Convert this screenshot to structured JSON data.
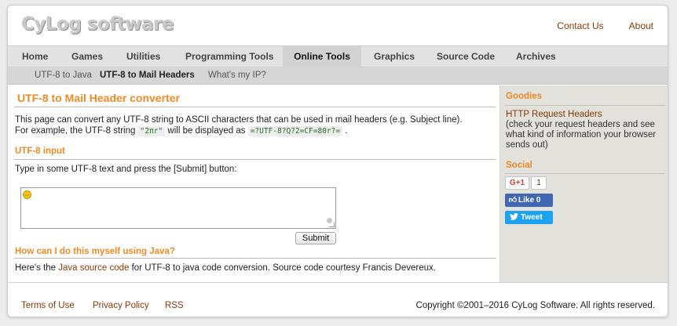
{
  "header": {
    "logo": "CyLog software",
    "links": [
      "Contact Us",
      "About"
    ]
  },
  "main_nav": {
    "items": [
      "Home",
      "Games",
      "Utilities",
      "Programming Tools",
      "Online Tools",
      "Graphics",
      "Source Code",
      "Archives"
    ],
    "active": "Online Tools"
  },
  "sub_nav": {
    "items": [
      "UTF-8 to Java",
      "UTF-8 to Mail Headers",
      "What's my IP?"
    ],
    "active": "UTF-8 to Mail Headers"
  },
  "content": {
    "title": "UTF-8 to Mail Header converter",
    "intro_line1": "This page can convert any UTF-8 string to ASCII characters that can be used in mail headers (e.g. Subject line).",
    "intro_line2_a": "For example, the UTF-8 string",
    "example_input": "\"2πr\"",
    "intro_line2_b": "will be displayed as",
    "example_output": "=?UTF-8?Q?2=CF=80r?=",
    "intro_line2_c": ".",
    "section_input_title": "UTF-8 input",
    "input_instruction": "Type in some UTF-8 text and press the [Submit] button:",
    "textarea_value": "",
    "submit_label": "Submit",
    "section_java_title": "How can I do this myself using Java?",
    "java_text_a": "Here's the",
    "java_link": "Java source code",
    "java_text_b": "for UTF-8 to java code conversion. Source code courtesy Francis Devereux."
  },
  "sidebar": {
    "goodies_title": "Goodies",
    "goodies_link": "HTTP Request Headers",
    "goodies_desc": [
      "(check your request headers and see",
      "what kind of information your browser",
      "sends out)"
    ],
    "social_title": "Social",
    "gplus_label": "G+1",
    "gplus_count": "1",
    "like_label": "Like 0",
    "tweet_label": "Tweet"
  },
  "footer": {
    "links": [
      "Terms of Use",
      "Privacy Policy",
      "RSS"
    ],
    "copyright": "Copyright ©2001–2016 CyLog Software. All rights reserved."
  },
  "colors": {
    "accent_orange": "#f08a24",
    "link_brown": "#8a3a08",
    "facebook_blue": "#4267b2",
    "twitter_blue": "#1da1f2",
    "gplus_red": "#d73d32"
  }
}
